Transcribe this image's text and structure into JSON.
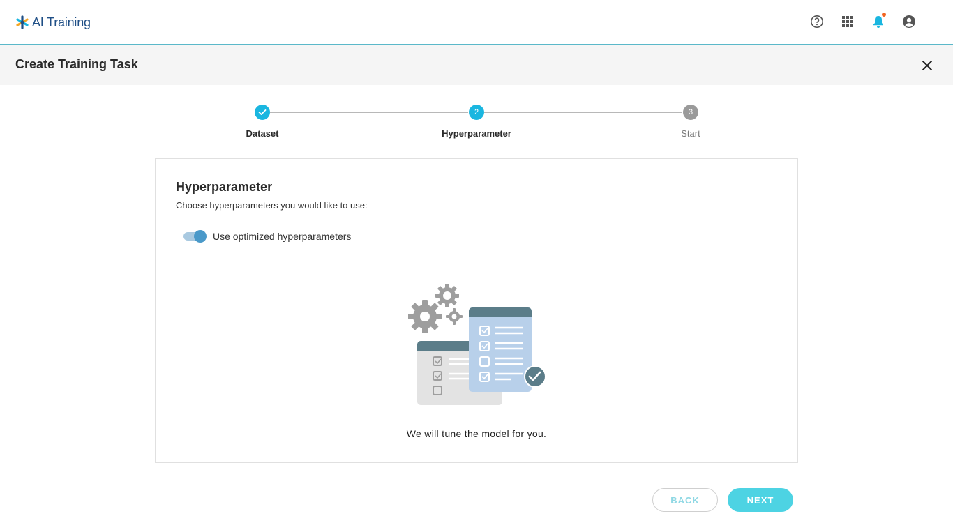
{
  "app": {
    "name": "AI Training",
    "icons": [
      "help-icon",
      "apps-grid-icon",
      "notification-bell-icon",
      "account-icon"
    ],
    "accent_color": "#1ab6e0",
    "notification_dot_color": "#f26522"
  },
  "page": {
    "title": "Create Training Task"
  },
  "stepper": {
    "steps": [
      {
        "number": "1",
        "label": "Dataset",
        "state": "done"
      },
      {
        "number": "2",
        "label": "Hyperparameter",
        "state": "active"
      },
      {
        "number": "3",
        "label": "Start",
        "state": "todo"
      }
    ]
  },
  "card": {
    "title": "Hyperparameter",
    "subtitle": "Choose hyperparameters you would like to use:",
    "toggle_label": "Use optimized hyperparameters",
    "toggle_on": true,
    "caption": "We will tune the model for you."
  },
  "footer": {
    "back_label": "BACK",
    "next_label": "NEXT"
  }
}
